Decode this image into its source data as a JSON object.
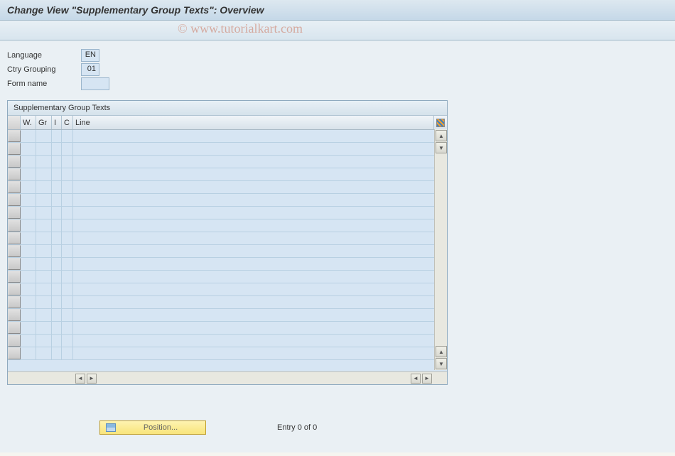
{
  "title": "Change View \"Supplementary Group Texts\": Overview",
  "watermark": "© www.tutorialkart.com",
  "fields": {
    "language": {
      "label": "Language",
      "value": "EN"
    },
    "ctry_grouping": {
      "label": "Ctry Grouping",
      "value": "01"
    },
    "form_name": {
      "label": "Form name",
      "value": ""
    }
  },
  "panel": {
    "title": "Supplementary Group Texts",
    "columns": {
      "w": "W.",
      "gr": "Gr",
      "i": "I",
      "c": "C",
      "line": "Line"
    },
    "rows": []
  },
  "footer": {
    "position_label": "Position...",
    "entry_text": "Entry 0 of 0"
  }
}
